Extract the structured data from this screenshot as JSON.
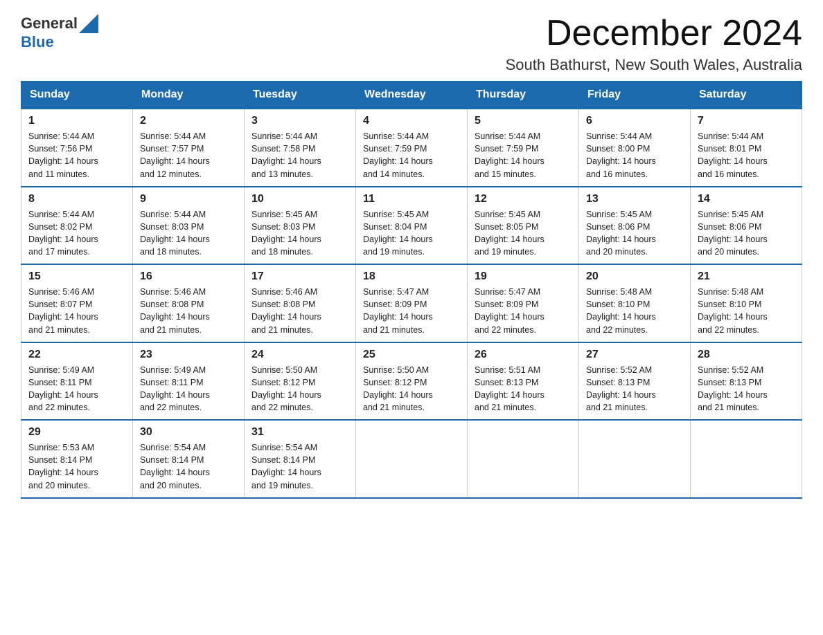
{
  "logo": {
    "text_general": "General",
    "text_blue": "Blue"
  },
  "header": {
    "month": "December 2024",
    "location": "South Bathurst, New South Wales, Australia"
  },
  "weekdays": [
    "Sunday",
    "Monday",
    "Tuesday",
    "Wednesday",
    "Thursday",
    "Friday",
    "Saturday"
  ],
  "weeks": [
    [
      {
        "day": "1",
        "sunrise": "5:44 AM",
        "sunset": "7:56 PM",
        "daylight": "14 hours and 11 minutes."
      },
      {
        "day": "2",
        "sunrise": "5:44 AM",
        "sunset": "7:57 PM",
        "daylight": "14 hours and 12 minutes."
      },
      {
        "day": "3",
        "sunrise": "5:44 AM",
        "sunset": "7:58 PM",
        "daylight": "14 hours and 13 minutes."
      },
      {
        "day": "4",
        "sunrise": "5:44 AM",
        "sunset": "7:59 PM",
        "daylight": "14 hours and 14 minutes."
      },
      {
        "day": "5",
        "sunrise": "5:44 AM",
        "sunset": "7:59 PM",
        "daylight": "14 hours and 15 minutes."
      },
      {
        "day": "6",
        "sunrise": "5:44 AM",
        "sunset": "8:00 PM",
        "daylight": "14 hours and 16 minutes."
      },
      {
        "day": "7",
        "sunrise": "5:44 AM",
        "sunset": "8:01 PM",
        "daylight": "14 hours and 16 minutes."
      }
    ],
    [
      {
        "day": "8",
        "sunrise": "5:44 AM",
        "sunset": "8:02 PM",
        "daylight": "14 hours and 17 minutes."
      },
      {
        "day": "9",
        "sunrise": "5:44 AM",
        "sunset": "8:03 PM",
        "daylight": "14 hours and 18 minutes."
      },
      {
        "day": "10",
        "sunrise": "5:45 AM",
        "sunset": "8:03 PM",
        "daylight": "14 hours and 18 minutes."
      },
      {
        "day": "11",
        "sunrise": "5:45 AM",
        "sunset": "8:04 PM",
        "daylight": "14 hours and 19 minutes."
      },
      {
        "day": "12",
        "sunrise": "5:45 AM",
        "sunset": "8:05 PM",
        "daylight": "14 hours and 19 minutes."
      },
      {
        "day": "13",
        "sunrise": "5:45 AM",
        "sunset": "8:06 PM",
        "daylight": "14 hours and 20 minutes."
      },
      {
        "day": "14",
        "sunrise": "5:45 AM",
        "sunset": "8:06 PM",
        "daylight": "14 hours and 20 minutes."
      }
    ],
    [
      {
        "day": "15",
        "sunrise": "5:46 AM",
        "sunset": "8:07 PM",
        "daylight": "14 hours and 21 minutes."
      },
      {
        "day": "16",
        "sunrise": "5:46 AM",
        "sunset": "8:08 PM",
        "daylight": "14 hours and 21 minutes."
      },
      {
        "day": "17",
        "sunrise": "5:46 AM",
        "sunset": "8:08 PM",
        "daylight": "14 hours and 21 minutes."
      },
      {
        "day": "18",
        "sunrise": "5:47 AM",
        "sunset": "8:09 PM",
        "daylight": "14 hours and 21 minutes."
      },
      {
        "day": "19",
        "sunrise": "5:47 AM",
        "sunset": "8:09 PM",
        "daylight": "14 hours and 22 minutes."
      },
      {
        "day": "20",
        "sunrise": "5:48 AM",
        "sunset": "8:10 PM",
        "daylight": "14 hours and 22 minutes."
      },
      {
        "day": "21",
        "sunrise": "5:48 AM",
        "sunset": "8:10 PM",
        "daylight": "14 hours and 22 minutes."
      }
    ],
    [
      {
        "day": "22",
        "sunrise": "5:49 AM",
        "sunset": "8:11 PM",
        "daylight": "14 hours and 22 minutes."
      },
      {
        "day": "23",
        "sunrise": "5:49 AM",
        "sunset": "8:11 PM",
        "daylight": "14 hours and 22 minutes."
      },
      {
        "day": "24",
        "sunrise": "5:50 AM",
        "sunset": "8:12 PM",
        "daylight": "14 hours and 22 minutes."
      },
      {
        "day": "25",
        "sunrise": "5:50 AM",
        "sunset": "8:12 PM",
        "daylight": "14 hours and 21 minutes."
      },
      {
        "day": "26",
        "sunrise": "5:51 AM",
        "sunset": "8:13 PM",
        "daylight": "14 hours and 21 minutes."
      },
      {
        "day": "27",
        "sunrise": "5:52 AM",
        "sunset": "8:13 PM",
        "daylight": "14 hours and 21 minutes."
      },
      {
        "day": "28",
        "sunrise": "5:52 AM",
        "sunset": "8:13 PM",
        "daylight": "14 hours and 21 minutes."
      }
    ],
    [
      {
        "day": "29",
        "sunrise": "5:53 AM",
        "sunset": "8:14 PM",
        "daylight": "14 hours and 20 minutes."
      },
      {
        "day": "30",
        "sunrise": "5:54 AM",
        "sunset": "8:14 PM",
        "daylight": "14 hours and 20 minutes."
      },
      {
        "day": "31",
        "sunrise": "5:54 AM",
        "sunset": "8:14 PM",
        "daylight": "14 hours and 19 minutes."
      },
      null,
      null,
      null,
      null
    ]
  ],
  "labels": {
    "sunrise": "Sunrise:",
    "sunset": "Sunset:",
    "daylight": "Daylight:"
  }
}
